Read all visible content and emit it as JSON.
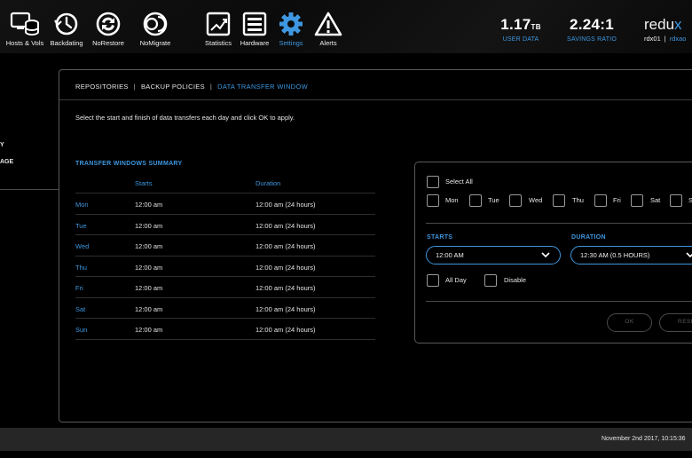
{
  "nav": {
    "items": [
      {
        "label": "Hosts & Vols",
        "icon": "hosts-volumes-icon"
      },
      {
        "label": "Backdating",
        "icon": "backdating-icon"
      },
      {
        "label": "NoRestore",
        "icon": "norestore-icon"
      },
      {
        "label": "NoMigrate",
        "icon": "nomigrate-icon"
      },
      {
        "label": "Statistics",
        "icon": "statistics-icon"
      },
      {
        "label": "Hardware",
        "icon": "hardware-icon"
      },
      {
        "label": "Settings",
        "icon": "gear-icon",
        "active": true
      },
      {
        "label": "Alerts",
        "icon": "alert-triangle-icon"
      }
    ]
  },
  "stats": {
    "user_data": {
      "value": "1.17",
      "unit": "TB",
      "label": "USER DATA"
    },
    "savings": {
      "value": "2.24:1",
      "label": "SAVINGS RATIO"
    }
  },
  "brand": {
    "text": "redu",
    "accent": "x"
  },
  "host": {
    "name": "rdx01",
    "separator": "|",
    "name2": "rdxao"
  },
  "sidebar": {
    "fragments": [
      "Y",
      "AGE"
    ]
  },
  "breadcrumb": {
    "items": [
      "REPOSITORIES",
      "BACKUP POLICIES",
      "DATA TRANSFER WINDOW"
    ],
    "separator": "|"
  },
  "instructions": "Select the start and finish of data transfers each day and click OK to apply.",
  "summary": {
    "title": "TRANSFER WINDOWS SUMMARY",
    "headers": {
      "starts": "Starts",
      "duration": "Duration"
    },
    "rows": [
      {
        "day": "Mon",
        "starts": "12:00 am",
        "duration": "12:00 am (24 hours)"
      },
      {
        "day": "Tue",
        "starts": "12:00 am",
        "duration": "12:00 am (24 hours)"
      },
      {
        "day": "Wed",
        "starts": "12:00 am",
        "duration": "12:00 am (24 hours)"
      },
      {
        "day": "Thu",
        "starts": "12:00 am",
        "duration": "12:00 am (24 hours)"
      },
      {
        "day": "Fri",
        "starts": "12:00 am",
        "duration": "12:00 am (24 hours)"
      },
      {
        "day": "Sat",
        "starts": "12:00 am",
        "duration": "12:00 am (24 hours)"
      },
      {
        "day": "Sun",
        "starts": "12:00 am",
        "duration": "12:00 am (24 hours)"
      }
    ]
  },
  "editor": {
    "select_all": "Select All",
    "days": [
      "Mon",
      "Tue",
      "Wed",
      "Thu",
      "Fri",
      "Sat",
      "S"
    ],
    "starts_label": "STARTS",
    "starts_value": "12:00 AM",
    "duration_label": "DURATION",
    "duration_value": "12:30 AM (0.5 HOURS)",
    "all_day": "All Day",
    "disable": "Disable",
    "ok": "OK",
    "reset": "RESE"
  },
  "footer": {
    "timestamp": "November 2nd 2017, 10:15:36"
  },
  "colors": {
    "accent": "#3e97e0",
    "background": "#000000",
    "footer": "#262626"
  }
}
